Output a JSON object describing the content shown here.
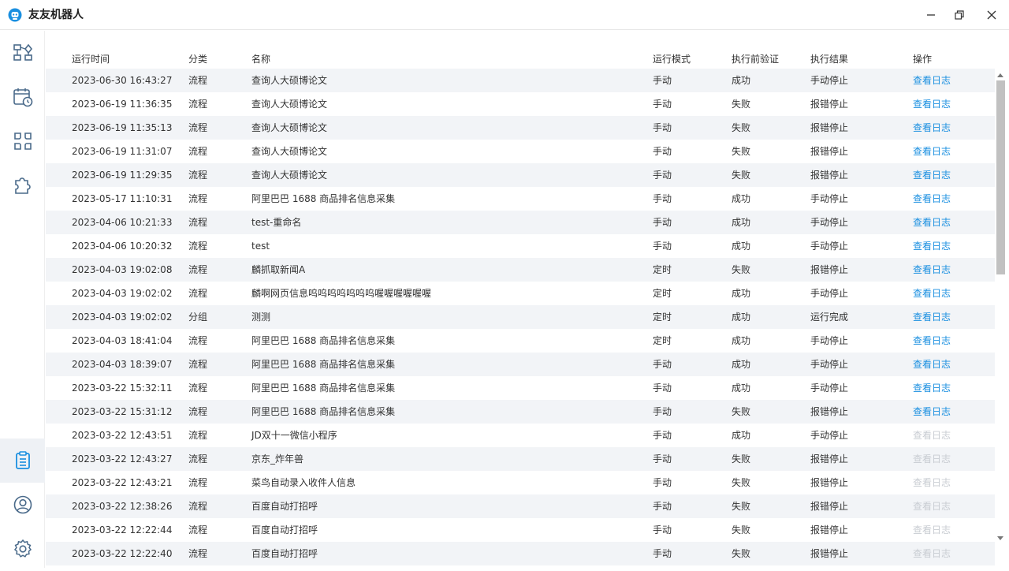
{
  "app": {
    "title": "友友机器人",
    "logo_icon": "robot-logo-icon",
    "accent": "#1a8fe0"
  },
  "window_controls": {
    "minimize_icon": "minimize-icon",
    "restore_icon": "restore-icon",
    "close_icon": "close-icon"
  },
  "sidebar": {
    "items": [
      {
        "name": "flow-icon"
      },
      {
        "name": "calendar-schedule-icon"
      },
      {
        "name": "apps-grid-icon"
      },
      {
        "name": "puzzle-plugin-icon"
      },
      {
        "name": "log-clipboard-icon",
        "active": true
      },
      {
        "name": "user-profile-icon"
      },
      {
        "name": "settings-gear-icon"
      }
    ]
  },
  "table": {
    "headers": [
      "运行时间",
      "分类",
      "名称",
      "运行模式",
      "执行前验证",
      "执行结果",
      "操作"
    ],
    "action_label": "查看日志",
    "rows": [
      {
        "time": "2023-06-30 16:43:27",
        "category": "流程",
        "name": "查询人大硕博论文",
        "mode": "手动",
        "verify": "成功",
        "result": "手动停止",
        "action": "查看日志",
        "enabled": true
      },
      {
        "time": "2023-06-19 11:36:35",
        "category": "流程",
        "name": "查询人大硕博论文",
        "mode": "手动",
        "verify": "失败",
        "result": "报错停止",
        "action": "查看日志",
        "enabled": true
      },
      {
        "time": "2023-06-19 11:35:13",
        "category": "流程",
        "name": "查询人大硕博论文",
        "mode": "手动",
        "verify": "失败",
        "result": "报错停止",
        "action": "查看日志",
        "enabled": true
      },
      {
        "time": "2023-06-19 11:31:07",
        "category": "流程",
        "name": "查询人大硕博论文",
        "mode": "手动",
        "verify": "失败",
        "result": "报错停止",
        "action": "查看日志",
        "enabled": true
      },
      {
        "time": "2023-06-19 11:29:35",
        "category": "流程",
        "name": "查询人大硕博论文",
        "mode": "手动",
        "verify": "失败",
        "result": "报错停止",
        "action": "查看日志",
        "enabled": true
      },
      {
        "time": "2023-05-17 11:10:31",
        "category": "流程",
        "name": "阿里巴巴 1688 商品排名信息采集",
        "mode": "手动",
        "verify": "成功",
        "result": "手动停止",
        "action": "查看日志",
        "enabled": true
      },
      {
        "time": "2023-04-06 10:21:33",
        "category": "流程",
        "name": "test-重命名",
        "mode": "手动",
        "verify": "成功",
        "result": "手动停止",
        "action": "查看日志",
        "enabled": true
      },
      {
        "time": "2023-04-06 10:20:32",
        "category": "流程",
        "name": "test",
        "mode": "手动",
        "verify": "成功",
        "result": "手动停止",
        "action": "查看日志",
        "enabled": true
      },
      {
        "time": "2023-04-03 19:02:08",
        "category": "流程",
        "name": "麟抓取新闻A",
        "mode": "定时",
        "verify": "失败",
        "result": "报错停止",
        "action": "查看日志",
        "enabled": true
      },
      {
        "time": "2023-04-03 19:02:02",
        "category": "流程",
        "name": "麟啊网页信息呜呜呜呜呜呜呜喔喔喔喔喔喔",
        "mode": "定时",
        "verify": "成功",
        "result": "手动停止",
        "action": "查看日志",
        "enabled": true
      },
      {
        "time": "2023-04-03 19:02:02",
        "category": "分组",
        "name": "测测",
        "mode": "定时",
        "verify": "成功",
        "result": "运行完成",
        "action": "查看日志",
        "enabled": true
      },
      {
        "time": "2023-04-03 18:41:04",
        "category": "流程",
        "name": "阿里巴巴 1688 商品排名信息采集",
        "mode": "定时",
        "verify": "成功",
        "result": "手动停止",
        "action": "查看日志",
        "enabled": true
      },
      {
        "time": "2023-04-03 18:39:07",
        "category": "流程",
        "name": "阿里巴巴 1688 商品排名信息采集",
        "mode": "手动",
        "verify": "成功",
        "result": "手动停止",
        "action": "查看日志",
        "enabled": true
      },
      {
        "time": "2023-03-22 15:32:11",
        "category": "流程",
        "name": "阿里巴巴 1688 商品排名信息采集",
        "mode": "手动",
        "verify": "成功",
        "result": "手动停止",
        "action": "查看日志",
        "enabled": true
      },
      {
        "time": "2023-03-22 15:31:12",
        "category": "流程",
        "name": "阿里巴巴 1688 商品排名信息采集",
        "mode": "手动",
        "verify": "失败",
        "result": "报错停止",
        "action": "查看日志",
        "enabled": true
      },
      {
        "time": "2023-03-22 12:43:51",
        "category": "流程",
        "name": "JD双十一微信小程序",
        "mode": "手动",
        "verify": "成功",
        "result": "手动停止",
        "action": "查看日志",
        "enabled": false
      },
      {
        "time": "2023-03-22 12:43:27",
        "category": "流程",
        "name": "京东_炸年兽",
        "mode": "手动",
        "verify": "失败",
        "result": "报错停止",
        "action": "查看日志",
        "enabled": false
      },
      {
        "time": "2023-03-22 12:43:21",
        "category": "流程",
        "name": "菜鸟自动录入收件人信息",
        "mode": "手动",
        "verify": "失败",
        "result": "报错停止",
        "action": "查看日志",
        "enabled": false
      },
      {
        "time": "2023-03-22 12:38:26",
        "category": "流程",
        "name": "百度自动打招呼",
        "mode": "手动",
        "verify": "失败",
        "result": "报错停止",
        "action": "查看日志",
        "enabled": false
      },
      {
        "time": "2023-03-22 12:22:44",
        "category": "流程",
        "name": "百度自动打招呼",
        "mode": "手动",
        "verify": "失败",
        "result": "报错停止",
        "action": "查看日志",
        "enabled": false
      },
      {
        "time": "2023-03-22 12:22:40",
        "category": "流程",
        "name": "百度自动打招呼",
        "mode": "手动",
        "verify": "失败",
        "result": "报错停止",
        "action": "查看日志",
        "enabled": false
      }
    ]
  }
}
